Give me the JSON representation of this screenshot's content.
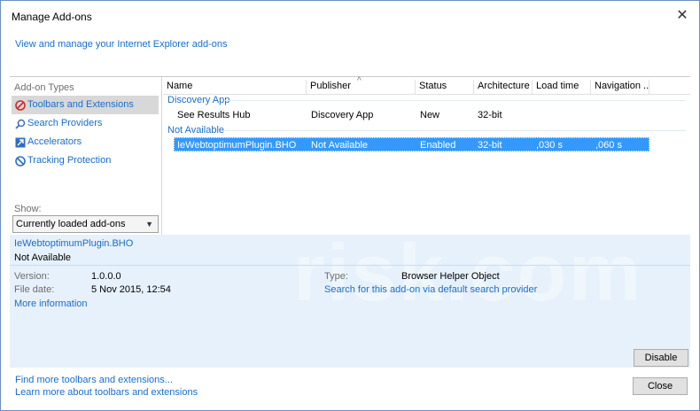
{
  "window": {
    "title": "Manage Add-ons",
    "close_glyph": "✕"
  },
  "intro_link": "View and manage your Internet Explorer add-ons",
  "left": {
    "heading": "Add-on Types",
    "types": [
      {
        "label": "Toolbars and Extensions",
        "icon": "toolbar-icon",
        "selected": true
      },
      {
        "label": "Search Providers",
        "icon": "search-icon",
        "selected": false
      },
      {
        "label": "Accelerators",
        "icon": "accelerator-icon",
        "selected": false
      },
      {
        "label": "Tracking Protection",
        "icon": "tracking-protection-icon",
        "selected": false
      }
    ],
    "show_label": "Show:",
    "show_value": "Currently loaded add-ons"
  },
  "grid": {
    "columns": [
      "Name",
      "Publisher",
      "Status",
      "Architecture",
      "Load time",
      "Navigation ..."
    ],
    "groups": [
      {
        "name": "Discovery App",
        "rows": [
          {
            "name": "See Results Hub",
            "publisher": "Discovery App",
            "status": "New",
            "architecture": "32-bit",
            "load_time": "",
            "navigation": ""
          }
        ]
      },
      {
        "name": "Not Available",
        "rows": [
          {
            "name": "IeWebtoptimumPlugin.BHO",
            "publisher": "Not Available",
            "status": "Enabled",
            "architecture": "32-bit",
            "load_time": ",030 s",
            "navigation": ",060 s"
          }
        ]
      }
    ]
  },
  "details": {
    "name": "IeWebtoptimumPlugin.BHO",
    "publisher": "Not Available",
    "version_label": "Version:",
    "version": "1.0.0.0",
    "file_date_label": "File date:",
    "file_date": "5 Nov 2015, 12:54",
    "more_info": "More information",
    "type_label": "Type:",
    "type": "Browser Helper Object",
    "search_link": "Search for this add-on via default search provider"
  },
  "buttons": {
    "disable": "Disable",
    "close": "Close"
  },
  "footer": {
    "find_more": "Find more toolbars and extensions...",
    "learn_more": "Learn more about toolbars and extensions"
  },
  "watermark": "risk.com",
  "colors": {
    "link": "#1a6dcc",
    "selection": "#3399ff",
    "details_bg": "#e6f1fb"
  }
}
